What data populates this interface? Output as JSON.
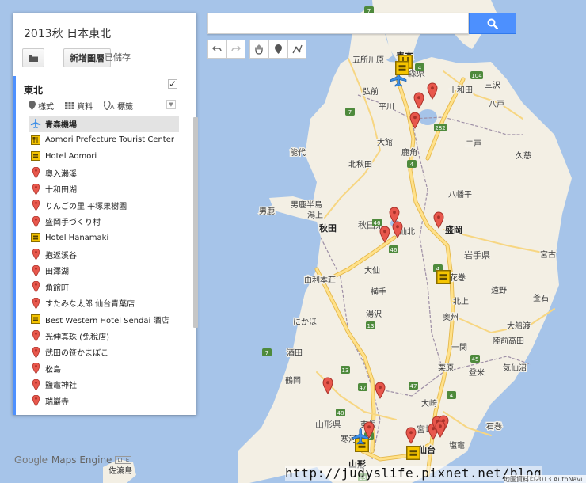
{
  "project": {
    "title": "2013秋 日本東北",
    "new_map_label": "新增圖層",
    "saved_label": "已儲存"
  },
  "layer": {
    "title": "東北",
    "checked": true,
    "tools": [
      {
        "icon": "style-marker-icon",
        "label": "樣式"
      },
      {
        "icon": "table-icon",
        "label": "資料"
      },
      {
        "icon": "label-marker-icon",
        "label": "標籤"
      }
    ]
  },
  "places": [
    {
      "label": "青森機場",
      "icon": "airport-icon",
      "selected": true
    },
    {
      "label": "Aomori Prefecture Tourist Center",
      "icon": "restaurant-icon"
    },
    {
      "label": "Hotel Aomori",
      "icon": "hotel-icon"
    },
    {
      "label": "奧入瀨溪",
      "icon": "red-pin-icon"
    },
    {
      "label": "十和田湖",
      "icon": "red-pin-icon"
    },
    {
      "label": "りんごの里 平塚果樹園",
      "icon": "red-pin-icon"
    },
    {
      "label": "盛岡手づくり村",
      "icon": "red-pin-icon"
    },
    {
      "label": "Hotel Hanamaki",
      "icon": "hotel-icon"
    },
    {
      "label": "抱返溪谷",
      "icon": "red-pin-icon"
    },
    {
      "label": "田澤湖",
      "icon": "red-pin-icon"
    },
    {
      "label": "角館町",
      "icon": "red-pin-icon"
    },
    {
      "label": "すたみな太郎 仙台青葉店",
      "icon": "red-pin-icon"
    },
    {
      "label": "Best Western Hotel Sendai 酒店",
      "icon": "hotel-icon"
    },
    {
      "label": "光伸真珠 (免稅店)",
      "icon": "red-pin-icon"
    },
    {
      "label": "武田の笹かまぼこ",
      "icon": "red-pin-icon"
    },
    {
      "label": "松島",
      "icon": "red-pin-icon"
    },
    {
      "label": "鹽竈神社",
      "icon": "red-pin-icon"
    },
    {
      "label": "瑞巖寺",
      "icon": "red-pin-icon"
    }
  ],
  "search": {
    "value": "",
    "placeholder": ""
  },
  "map_toolbar": [
    "undo-icon",
    "redo-icon",
    "pan-hand-icon",
    "add-marker-icon",
    "draw-line-icon"
  ],
  "map": {
    "labels": [
      {
        "text": "青森",
        "kind": "city"
      },
      {
        "text": "五所川原",
        "kind": "town"
      },
      {
        "text": "森県",
        "kind": "pref"
      },
      {
        "text": "弘前",
        "kind": "town"
      },
      {
        "text": "十和田",
        "kind": "town"
      },
      {
        "text": "三沢",
        "kind": "town"
      },
      {
        "text": "八戸",
        "kind": "town"
      },
      {
        "text": "平川",
        "kind": "town"
      },
      {
        "text": "大館",
        "kind": "town"
      },
      {
        "text": "二戸",
        "kind": "town"
      },
      {
        "text": "鹿角",
        "kind": "town"
      },
      {
        "text": "久慈",
        "kind": "town"
      },
      {
        "text": "能代",
        "kind": "town"
      },
      {
        "text": "北秋田",
        "kind": "town"
      },
      {
        "text": "八幡平",
        "kind": "town"
      },
      {
        "text": "男鹿",
        "kind": "town"
      },
      {
        "text": "男鹿半島",
        "kind": "town"
      },
      {
        "text": "潟上",
        "kind": "town"
      },
      {
        "text": "秋田",
        "kind": "city"
      },
      {
        "text": "秋田県",
        "kind": "pref"
      },
      {
        "text": "仙北",
        "kind": "town"
      },
      {
        "text": "盛岡",
        "kind": "city"
      },
      {
        "text": "岩手県",
        "kind": "pref"
      },
      {
        "text": "宮古",
        "kind": "town"
      },
      {
        "text": "大仙",
        "kind": "town"
      },
      {
        "text": "由利本荘",
        "kind": "town"
      },
      {
        "text": "花巻",
        "kind": "town"
      },
      {
        "text": "遠野",
        "kind": "town"
      },
      {
        "text": "釜石",
        "kind": "town"
      },
      {
        "text": "横手",
        "kind": "town"
      },
      {
        "text": "北上",
        "kind": "town"
      },
      {
        "text": "奥州",
        "kind": "town"
      },
      {
        "text": "にかほ",
        "kind": "town"
      },
      {
        "text": "湯沢",
        "kind": "town"
      },
      {
        "text": "大船渡",
        "kind": "town"
      },
      {
        "text": "陸前高田",
        "kind": "town"
      },
      {
        "text": "一関",
        "kind": "town"
      },
      {
        "text": "酒田",
        "kind": "town"
      },
      {
        "text": "気仙沼",
        "kind": "town"
      },
      {
        "text": "栗原",
        "kind": "town"
      },
      {
        "text": "登米",
        "kind": "town"
      },
      {
        "text": "鶴岡",
        "kind": "town"
      },
      {
        "text": "大崎",
        "kind": "town"
      },
      {
        "text": "石巻",
        "kind": "town"
      },
      {
        "text": "山形県",
        "kind": "pref"
      },
      {
        "text": "東根",
        "kind": "town"
      },
      {
        "text": "宮城県",
        "kind": "pref"
      },
      {
        "text": "寒河江",
        "kind": "town"
      },
      {
        "text": "塩竈",
        "kind": "town"
      },
      {
        "text": "山形",
        "kind": "city"
      },
      {
        "text": "仙台",
        "kind": "city"
      },
      {
        "text": "佐渡島",
        "kind": "town"
      }
    ],
    "shields": [
      "7",
      "7",
      "4",
      "104",
      "282",
      "46",
      "46",
      "4",
      "4",
      "13",
      "13",
      "7",
      "47",
      "47",
      "4",
      "45",
      "48",
      "6",
      "13"
    ],
    "colors": {
      "land": "#f3efe4",
      "sea": "#a6c4e9",
      "lake": "#a6c4e9",
      "road": "#ffe18a",
      "road_edge": "#e5b84a",
      "border": "#9e8fa6",
      "pin": "#e8574c",
      "hotel": "#f5c400"
    }
  },
  "footer": {
    "logo_google": "Google",
    "logo_engine": "Maps Engine",
    "logo_lite": "LITE",
    "watermark": "http://judyslife.pixnet.net/blog",
    "attribution": "地圖資料©2013 AutoNavi"
  }
}
